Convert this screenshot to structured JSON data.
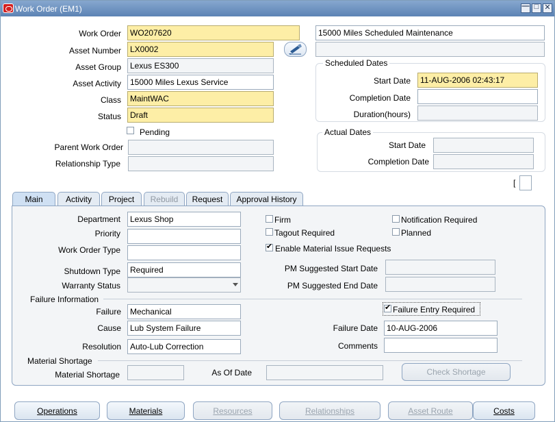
{
  "window": {
    "title": "Work Order (EM1)"
  },
  "header": {
    "work_order_label": "Work Order",
    "work_order": "WO207620",
    "work_order_desc": "15000 Miles Scheduled Maintenance",
    "asset_number_label": "Asset Number",
    "asset_number": "LX0002",
    "asset_group_label": "Asset Group",
    "asset_group": "Lexus ES300",
    "asset_activity_label": "Asset Activity",
    "asset_activity": "15000 Miles Lexus Service",
    "class_label": "Class",
    "class_value": "MaintWAC",
    "status_label": "Status",
    "status": "Draft",
    "pending_label": "Pending",
    "parent_wo_label": "Parent Work Order",
    "relationship_type_label": "Relationship Type",
    "bracket_text": "["
  },
  "scheduled_dates": {
    "title": "Scheduled Dates",
    "start_label": "Start Date",
    "start": "11-AUG-2006 02:43:17",
    "completion_label": "Completion Date",
    "duration_label": "Duration(hours)"
  },
  "actual_dates": {
    "title": "Actual Dates",
    "start_label": "Start Date",
    "completion_label": "Completion Date"
  },
  "tabs": [
    {
      "label": "Main",
      "state": "active"
    },
    {
      "label": "Activity",
      "state": "normal"
    },
    {
      "label": "Project",
      "state": "normal"
    },
    {
      "label": "Rebuild",
      "state": "disabled"
    },
    {
      "label": "Request",
      "state": "normal"
    },
    {
      "label": "Approval History",
      "state": "normal"
    }
  ],
  "main": {
    "department_label": "Department",
    "department": "Lexus Shop",
    "priority_label": "Priority",
    "wo_type_label": "Work Order Type",
    "shutdown_label": "Shutdown Type",
    "shutdown": "Required",
    "warranty_label": "Warranty Status",
    "firm_label": "Firm",
    "tagout_label": "Tagout Required",
    "notification_label": "Notification Required",
    "planned_label": "Planned",
    "enable_material_label": "Enable Material Issue Requests",
    "pm_start_label": "PM Suggested Start Date",
    "pm_end_label": "PM Suggested End Date",
    "failure_info_title": "Failure Information",
    "failure_label": "Failure",
    "failure": "Mechanical",
    "cause_label": "Cause",
    "cause": "Lub System Failure",
    "resolution_label": "Resolution",
    "resolution": "Auto-Lub Correction",
    "failure_entry_label": "Failure Entry Required",
    "failure_date_label": "Failure Date",
    "failure_date": "10-AUG-2006",
    "comments_label": "Comments",
    "material_shortage_title": "Material Shortage",
    "material_shortage_label": "Material Shortage",
    "as_of_date_label": "As Of Date",
    "check_shortage_label": "Check Shortage"
  },
  "buttons": {
    "operations": "Operations",
    "materials": "Materials",
    "resources": "Resources",
    "relationships": "Relationships",
    "asset_route": "Asset Route",
    "costs": "Costs"
  },
  "colors": {
    "required_field": "#fdeea6",
    "titlebar": "#5c83b4",
    "tab_panel": "#f3f5f7"
  }
}
